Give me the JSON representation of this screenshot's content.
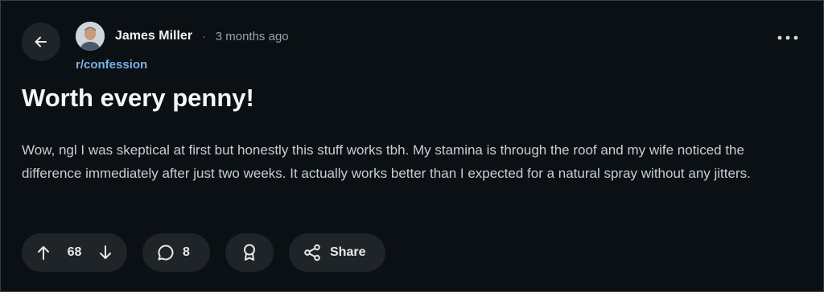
{
  "post": {
    "author": "James Miller",
    "separator": "·",
    "time_ago": "3 months ago",
    "subreddit": "r/confession",
    "title": "Worth every penny!",
    "body": "Wow, ngl I was skeptical at first but honestly this stuff works tbh. My stamina is through the roof and my wife noticed the difference immediately after just two weeks. It actually works better than I expected for a natural spray without any jitters."
  },
  "actions": {
    "vote_count": "68",
    "comment_count": "8",
    "share_label": "Share"
  },
  "icons": {
    "back": "arrow-left-icon",
    "more": "more-horizontal-icon",
    "upvote": "arrow-up-icon",
    "downvote": "arrow-down-icon",
    "comment": "comment-bubble-icon",
    "award": "award-ribbon-icon",
    "share": "share-nodes-icon"
  },
  "colors": {
    "background": "#0b1014",
    "pill": "#1f2428",
    "subreddit_link": "#7ab1e8"
  }
}
